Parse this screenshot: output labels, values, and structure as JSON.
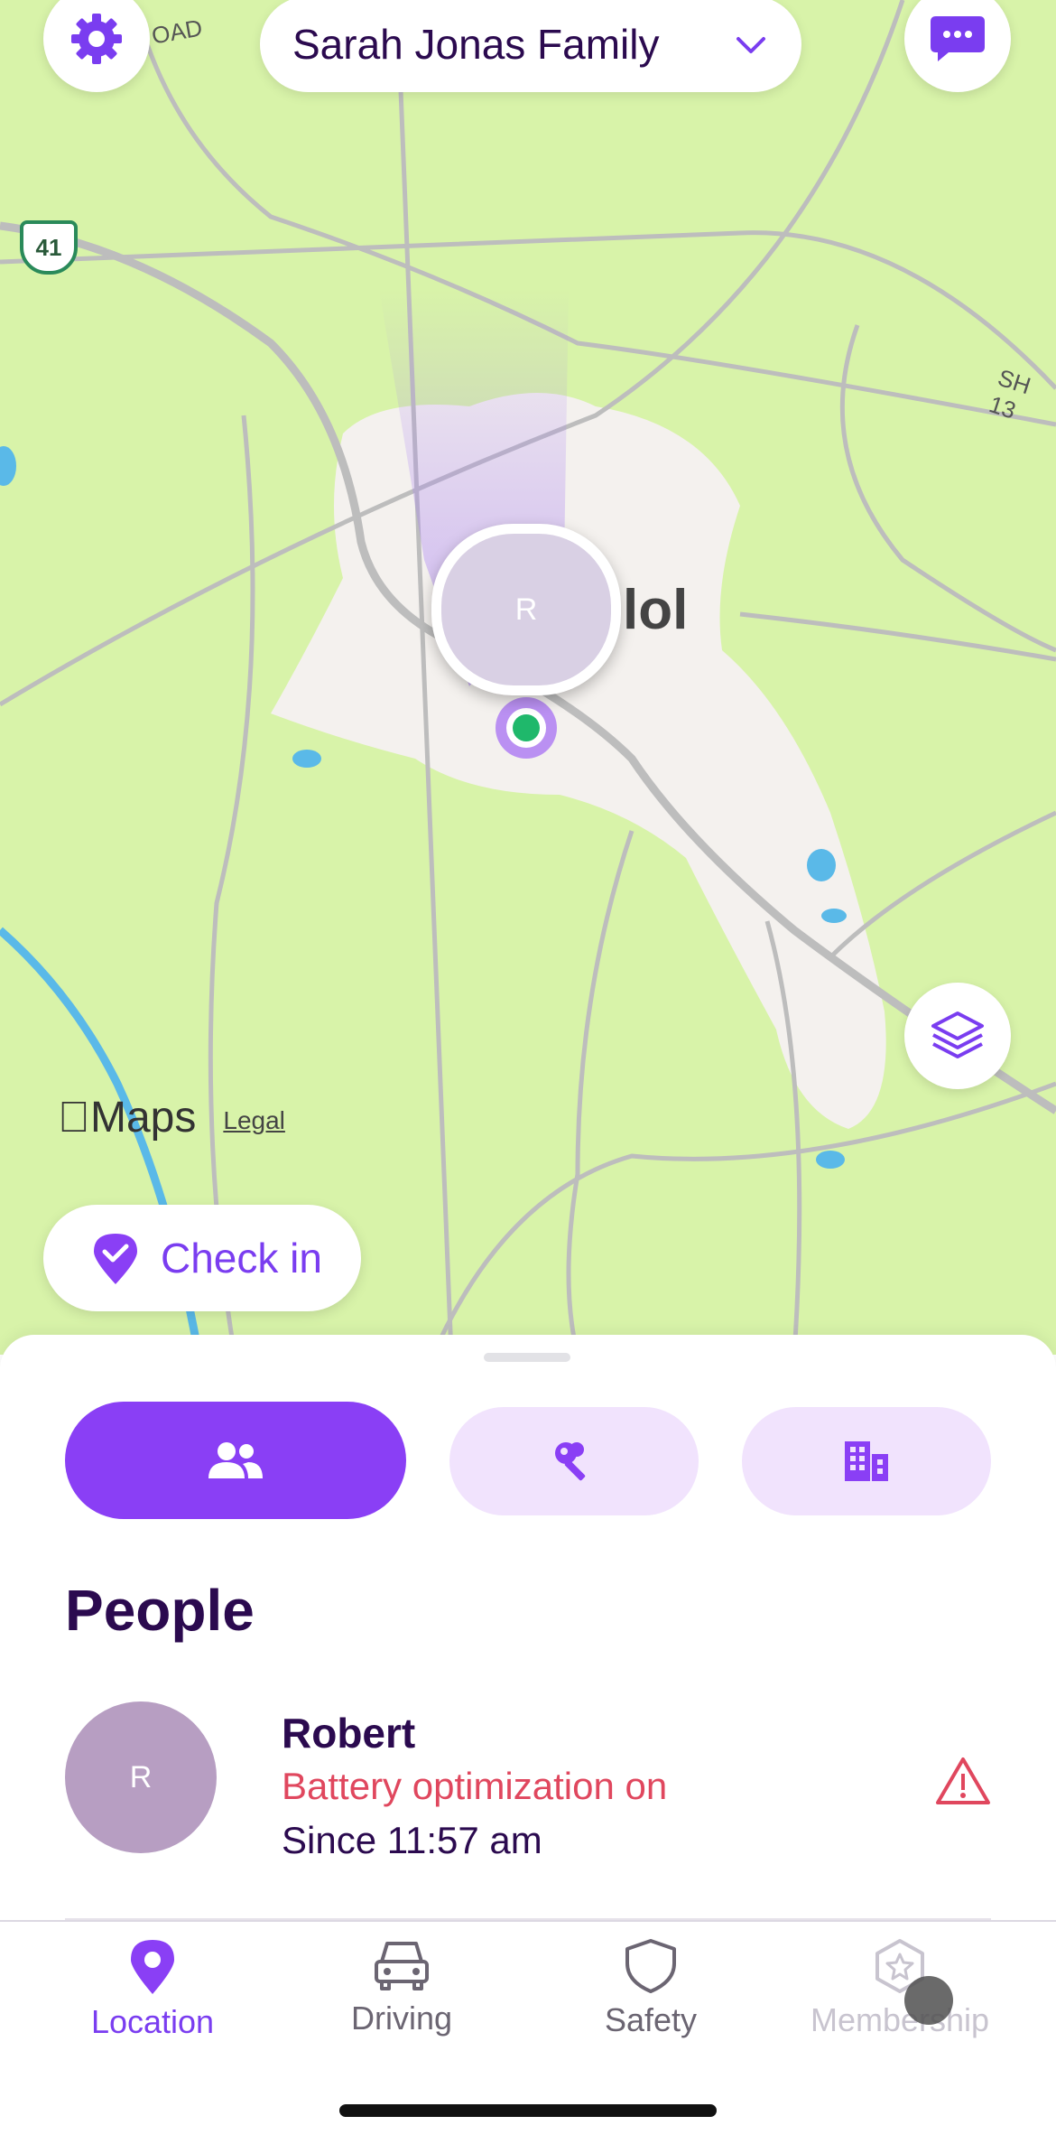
{
  "header": {
    "circle_name": "Sarah Jonas Family",
    "settings_icon": "gear-icon",
    "dropdown_icon": "chevron-down-icon",
    "messages_icon": "chat-bubble-icon"
  },
  "map": {
    "road_label_top": "OAD",
    "highway_shield": "41",
    "road_label_right": "SH 13",
    "place_label": "lol",
    "member_pin_initial": "R",
    "attribution_brand": "Maps",
    "attribution_legal": "Legal",
    "layers_icon": "layers-icon",
    "colors": {
      "land": "#d8f3a9",
      "urban": "#f4f1ee",
      "road": "#bdbdbd",
      "water": "#5ab9e8",
      "accent": "#8a3ff5"
    }
  },
  "check_in": {
    "label": "Check in",
    "icon": "location-check-icon"
  },
  "sheet": {
    "segments": [
      {
        "icon": "people-icon",
        "active": true
      },
      {
        "icon": "keys-icon",
        "active": false
      },
      {
        "icon": "buildings-icon",
        "active": false
      }
    ],
    "section_title": "People",
    "people": [
      {
        "initial": "R",
        "name": "Robert",
        "status": "Battery optimization on",
        "since": "Since 11:57 am",
        "alert_icon": "warning-triangle-icon"
      }
    ]
  },
  "tabbar": {
    "tabs": [
      {
        "label": "Location",
        "icon": "location-pin-icon",
        "active": true
      },
      {
        "label": "Driving",
        "icon": "car-icon",
        "active": false
      },
      {
        "label": "Safety",
        "icon": "shield-icon",
        "active": false
      },
      {
        "label": "Membership",
        "icon": "star-badge-icon",
        "active": false,
        "dimmed": true
      }
    ],
    "colors": {
      "active": "#7a3df0",
      "inactive": "#6b6572",
      "dimmed": "#c8c4cf"
    }
  }
}
